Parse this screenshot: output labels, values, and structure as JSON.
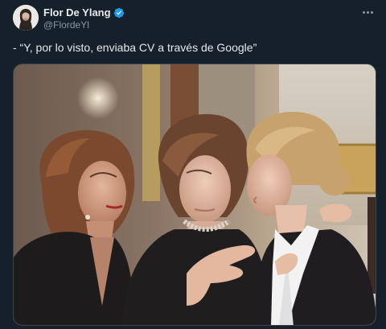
{
  "post": {
    "author_name": "Flor De Ylang",
    "author_handle": "@FlordeYl",
    "verified": true,
    "text": "- “Y, por lo visto, enviaba CV a través de Google”",
    "more_icon": "more-horizontal-icon",
    "verified_icon": "verified-badge-icon"
  },
  "media": {
    "type": "photo",
    "subject": "three women whispering"
  },
  "colors": {
    "background": "#15202b",
    "text_primary": "#e7e9ea",
    "text_secondary": "#8b98a5",
    "verified": "#1d9bf0",
    "border": "#38444d"
  }
}
